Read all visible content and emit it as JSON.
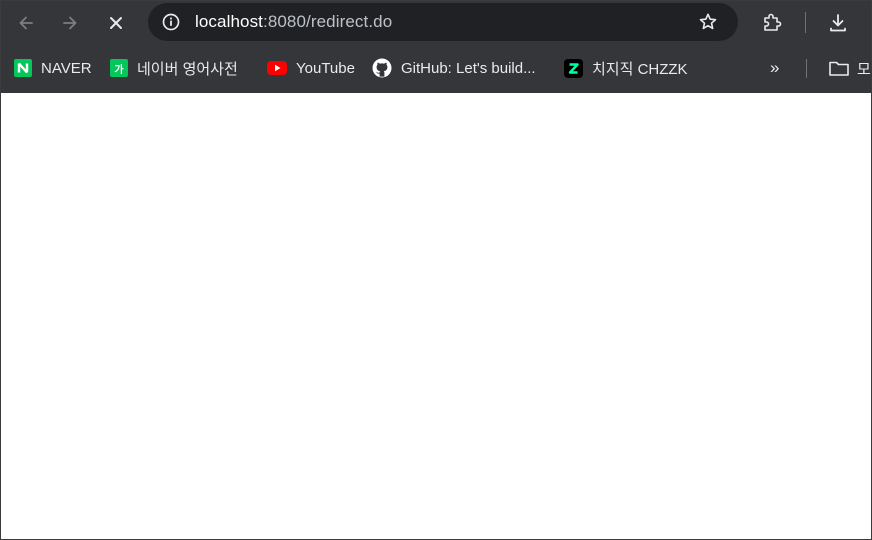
{
  "toolbar": {
    "back_icon": "back-arrow-icon",
    "forward_icon": "forward-arrow-icon",
    "stop_icon": "close-icon",
    "url_host": "localhost",
    "url_rest": ":8080/redirect.do",
    "site_info_icon": "info-icon",
    "bookmark_star_icon": "star-icon",
    "extensions_icon": "puzzle-icon",
    "download_icon": "download-icon"
  },
  "bookmarks": {
    "items": [
      {
        "label": "NAVER",
        "icon": "naver-icon",
        "color": "#03c75a",
        "glyph": "N"
      },
      {
        "label": "네이버 영어사전",
        "icon": "naver-dictionary-icon",
        "color": "#03c75a",
        "glyph": "가"
      },
      {
        "label": "YouTube",
        "icon": "youtube-icon",
        "color": "#ff0000"
      },
      {
        "label": "GitHub: Let's build...",
        "icon": "github-icon",
        "color": "#ffffff"
      },
      {
        "label": "치지직 CHZZK",
        "icon": "chzzk-icon",
        "color": "#00ffa3"
      }
    ],
    "overflow_label": "»",
    "folder_label": "모"
  },
  "colors": {
    "toolbar_bg": "#35363a",
    "omnibox_bg": "#202124",
    "text": "#e8eaed",
    "page_bg": "#ffffff"
  }
}
